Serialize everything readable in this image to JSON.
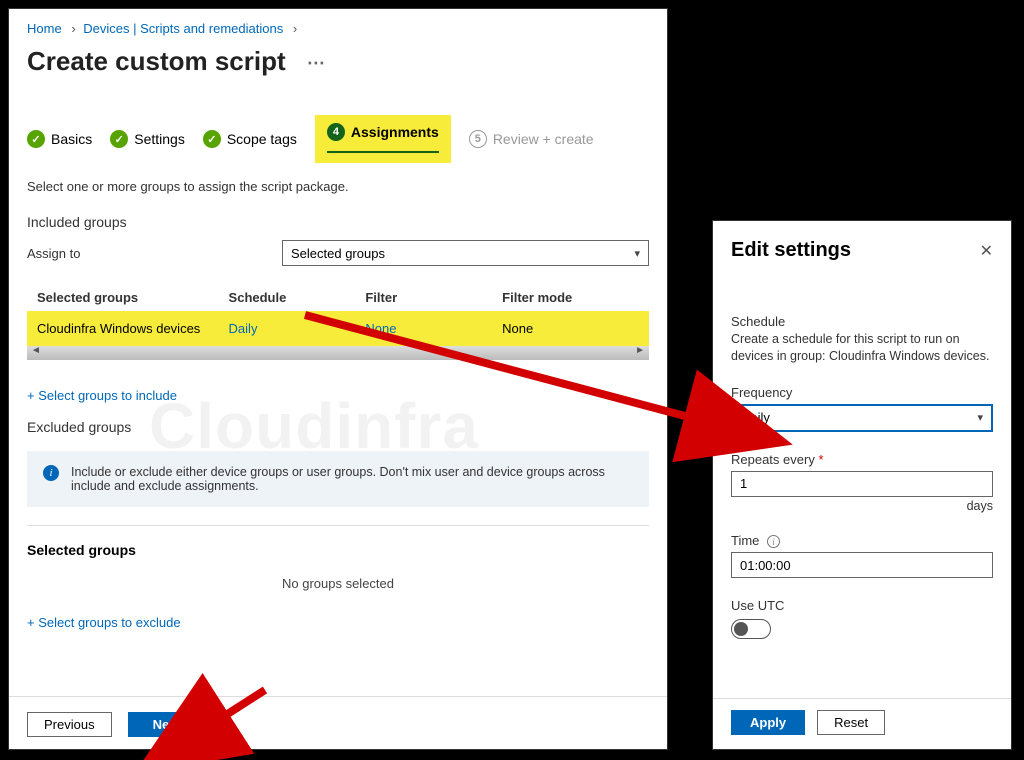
{
  "breadcrumb": {
    "home": "Home",
    "devices": "Devices | Scripts and remediations"
  },
  "page": {
    "title": "Create custom script"
  },
  "steps": {
    "basics": "Basics",
    "settings": "Settings",
    "scope": "Scope tags",
    "active_num": "4",
    "assignments": "Assignments",
    "review_num": "5",
    "review": "Review + create"
  },
  "instruction": "Select one or more groups to assign the script package.",
  "included_groups_label": "Included groups",
  "assign_to_label": "Assign to",
  "assign_to_value": "Selected groups",
  "grid": {
    "headers": {
      "c1": "Selected groups",
      "c2": "Schedule",
      "c3": "Filter",
      "c4": "Filter mode"
    },
    "row": {
      "c1": "Cloudinfra Windows devices",
      "c2": "Daily",
      "c3": "None",
      "c4": "None"
    }
  },
  "select_include_link": "+ Select groups to include",
  "excluded_groups_label": "Excluded groups",
  "info_text": "Include or exclude either device groups or user groups. Don't mix user and device groups across include and exclude assignments.",
  "selected_groups_label": "Selected groups",
  "no_groups_text": "No groups selected",
  "select_exclude_link": "+ Select groups to exclude",
  "buttons": {
    "previous": "Previous",
    "next": "Next"
  },
  "side": {
    "title": "Edit settings",
    "schedule_label": "Schedule",
    "schedule_desc": "Create a schedule for this script to run on devices in group: Cloudinfra Windows devices.",
    "frequency_label": "Frequency",
    "frequency_value": "Daily",
    "repeats_label": "Repeats every",
    "repeats_value": "1",
    "repeats_unit": "days",
    "time_label": "Time",
    "time_value": "01:00:00",
    "use_utc_label": "Use UTC",
    "apply": "Apply",
    "reset": "Reset"
  },
  "watermark": "Cloudinfra"
}
